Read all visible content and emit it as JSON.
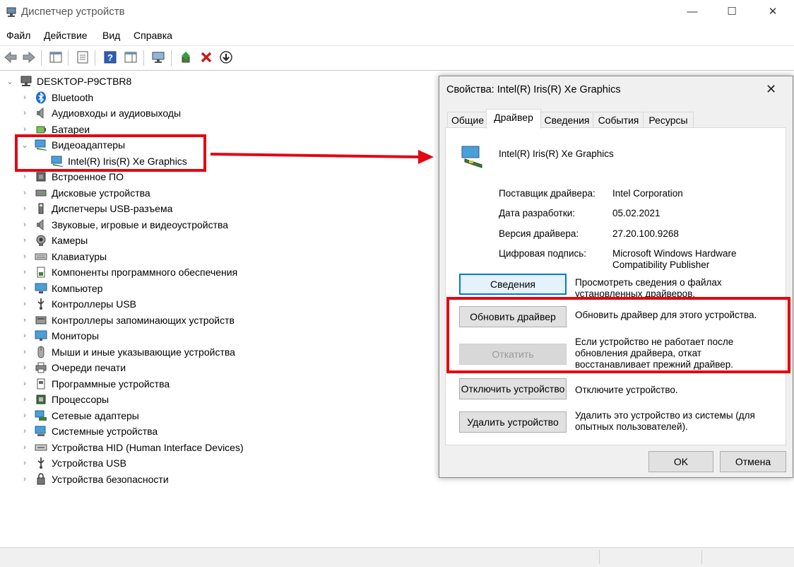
{
  "window": {
    "title": "Диспетчер устройств",
    "controls": {
      "minimize": "—",
      "maximize": "☐",
      "close": "✕"
    }
  },
  "menu": [
    "Файл",
    "Действие",
    "Вид",
    "Справка"
  ],
  "tree": {
    "root": "DESKTOP-P9CTBR8",
    "items": [
      {
        "label": "Bluetooth",
        "icon": "bluetooth-icon"
      },
      {
        "label": "Аудиовходы и аудиовыходы",
        "icon": "speaker-icon"
      },
      {
        "label": "Батареи",
        "icon": "battery-icon"
      },
      {
        "label": "Видеоадаптеры",
        "icon": "display-adapter-icon"
      },
      {
        "label": "Intel(R) Iris(R) Xe Graphics",
        "icon": "display-adapter-icon"
      },
      {
        "label": "Встроенное ПО",
        "icon": "firmware-icon"
      },
      {
        "label": "Дисковые устройства",
        "icon": "disk-icon"
      },
      {
        "label": "Диспетчеры USB-разъема",
        "icon": "usb-connector-icon"
      },
      {
        "label": "Звуковые, игровые и видеоустройства",
        "icon": "speaker-icon"
      },
      {
        "label": "Камеры",
        "icon": "camera-icon"
      },
      {
        "label": "Клавиатуры",
        "icon": "keyboard-icon"
      },
      {
        "label": "Компоненты программного обеспечения",
        "icon": "software-component-icon"
      },
      {
        "label": "Компьютер",
        "icon": "computer-icon"
      },
      {
        "label": "Контроллеры USB",
        "icon": "usb-icon"
      },
      {
        "label": "Контроллеры запоминающих устройств",
        "icon": "storage-controller-icon"
      },
      {
        "label": "Мониторы",
        "icon": "monitor-icon"
      },
      {
        "label": "Мыши и иные указывающие устройства",
        "icon": "mouse-icon"
      },
      {
        "label": "Очереди печати",
        "icon": "printer-icon"
      },
      {
        "label": "Программные устройства",
        "icon": "software-device-icon"
      },
      {
        "label": "Процессоры",
        "icon": "processor-icon"
      },
      {
        "label": "Сетевые адаптеры",
        "icon": "network-adapter-icon"
      },
      {
        "label": "Системные устройства",
        "icon": "system-device-icon"
      },
      {
        "label": "Устройства HID (Human Interface Devices)",
        "icon": "hid-icon"
      },
      {
        "label": "Устройства USB",
        "icon": "usb-icon"
      },
      {
        "label": "Устройства безопасности",
        "icon": "security-device-icon"
      }
    ]
  },
  "dialog": {
    "title": "Свойства: Intel(R) Iris(R) Xe Graphics",
    "close": "✕",
    "tabs": [
      "Общие",
      "Драйвер",
      "Сведения",
      "События",
      "Ресурсы"
    ],
    "active_tab": "Драйвер",
    "device_name": "Intel(R) Iris(R) Xe Graphics",
    "fields": [
      {
        "label": "Поставщик драйвера:",
        "value": "Intel Corporation"
      },
      {
        "label": "Дата разработки:",
        "value": "05.02.2021"
      },
      {
        "label": "Версия драйвера:",
        "value": "27.20.100.9268"
      },
      {
        "label": "Цифровая подпись:",
        "value": "Microsoft Windows Hardware Compatibility Publisher"
      }
    ],
    "actions": [
      {
        "button": "Сведения",
        "description": "Просмотреть сведения о файлах установленных драйверов."
      },
      {
        "button": "Обновить драйвер",
        "description": "Обновить драйвер для этого устройства."
      },
      {
        "button": "Откатить",
        "description": "Если устройство не работает после обновления драйвера, откат восстанавливает прежний драйвер."
      },
      {
        "button": "Отключить устройство",
        "description": "Отключите устройство."
      },
      {
        "button": "Удалить устройство",
        "description": "Удалить это устройство из системы (для опытных пользователей)."
      }
    ],
    "ok": "OK",
    "cancel": "Отмена"
  },
  "colors": {
    "highlight": "#e30613",
    "accent": "#0078d7"
  }
}
